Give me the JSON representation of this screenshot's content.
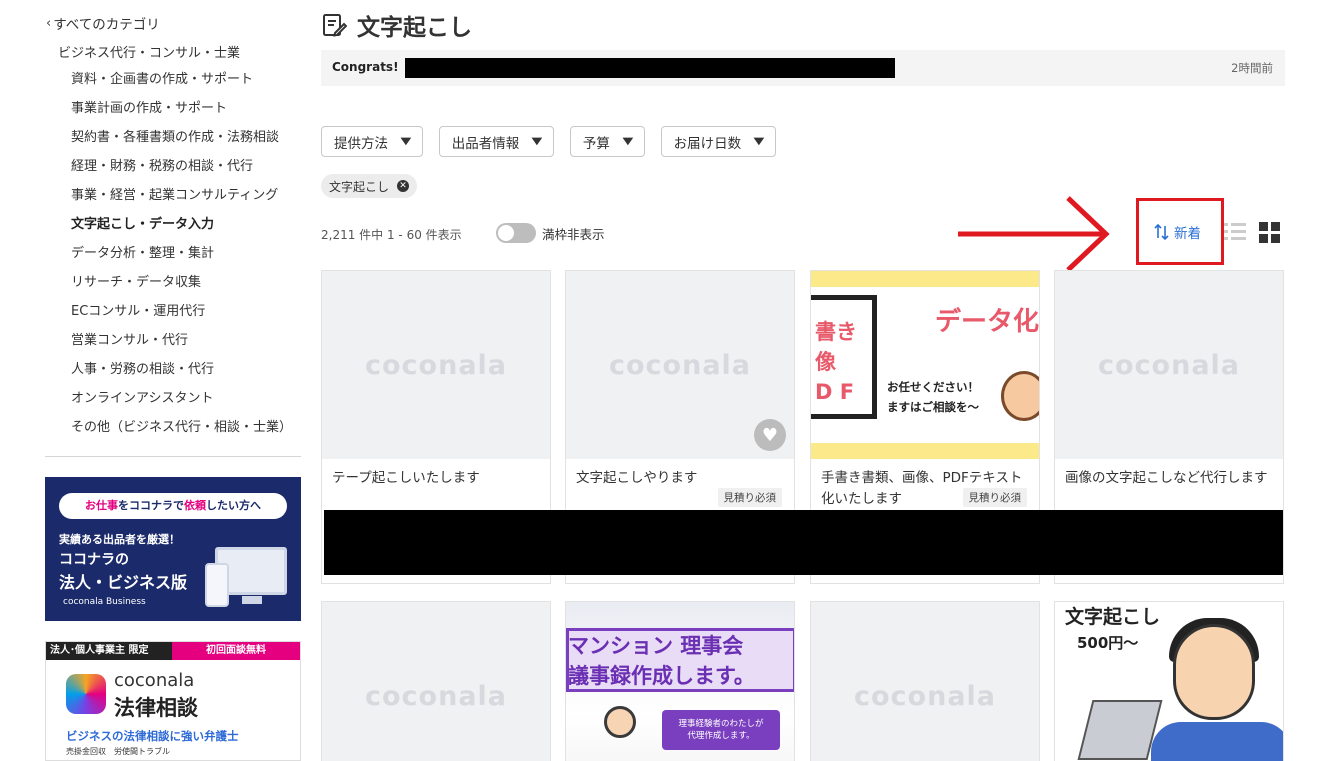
{
  "sidebar": {
    "back_label": "すべてのカテゴリ",
    "parent_label": "ビジネス代行・コンサル・士業",
    "items": [
      "資料・企画書の作成・サポート",
      "事業計画の作成・サポート",
      "契約書・各種書類の作成・法務相談",
      "経理・財務・税務の相談・代行",
      "事業・経営・起業コンサルティング",
      "文字起こし・データ入力",
      "データ分析・整理・集計",
      "リサーチ・データ収集",
      "ECコンサル・運用代行",
      "営業コンサル・代行",
      "人事・労務の相談・代行",
      "オンラインアシスタント",
      "その他（ビジネス代行・相談・士業）"
    ],
    "active_index": 5,
    "banner_business": {
      "pill_prefix": "お仕事",
      "pill_mid1": "をココナラで",
      "pill_em": "依頼",
      "pill_suffix": "したい方へ",
      "line1": "実績ある出品者を厳選！",
      "line2": "ココナラの",
      "line3": "法人・ビジネス版",
      "line4": "coconala Business"
    },
    "banner_legal": {
      "tag_left": "法人･個人事業主 限定",
      "tag_right": "初回面談無料",
      "brand": "coconala",
      "title": "法律相談",
      "sub": "ビジネスの法律相談に強い弁護士",
      "small": "売掛金回収　労使間トラブル"
    }
  },
  "header": {
    "title": "文字起こし",
    "icon": "edit-document-icon"
  },
  "notice": {
    "label": "Congrats!",
    "time": "2時間前"
  },
  "filters": [
    {
      "label": "提供方法"
    },
    {
      "label": "出品者情報"
    },
    {
      "label": "予算"
    },
    {
      "label": "お届け日数"
    }
  ],
  "active_chip": "文字起こし",
  "results": {
    "count_text": "2,211 件中 1 - 60 件表示",
    "toggle_label": "満枠非表示",
    "sort_label": "新着"
  },
  "colors": {
    "accent_blue": "#2a6fd6",
    "highlight_red": "#e0181f",
    "brand_pink": "#e4007f"
  },
  "cards": [
    {
      "title": "テープ起こしいたします",
      "thumb": "coconala",
      "badge": ""
    },
    {
      "title": "文字起こしやります",
      "thumb": "coconala",
      "badge": "見積り必須"
    },
    {
      "title": "手書き書類、画像、PDFテキスト化いたします",
      "thumb": "image",
      "badge": "見積り必須",
      "thumb_text": {
        "k1a": "書き",
        "k1b": "像",
        "k1c": "D F",
        "k2": "データ化",
        "k3a": "お任せください！",
        "k3b": "ますはご相談を～"
      }
    },
    {
      "title": "画像の文字起こしなど代行します",
      "thumb": "coconala",
      "badge": ""
    },
    {
      "title": "",
      "thumb": "coconala",
      "badge": ""
    },
    {
      "title": "",
      "thumb": "image",
      "badge": "",
      "thumb_text": {
        "t1": "マンション 理事会",
        "t2": "議事録作成します。",
        "bubble1": "理事経験者のわたしが",
        "bubble2": "代理作成します。"
      }
    },
    {
      "title": "",
      "thumb": "coconala",
      "badge": ""
    },
    {
      "title": "",
      "thumb": "image",
      "badge": "",
      "thumb_text": {
        "t1": "文字起こし",
        "t2": "500円～"
      }
    }
  ],
  "watermark": "coconala"
}
